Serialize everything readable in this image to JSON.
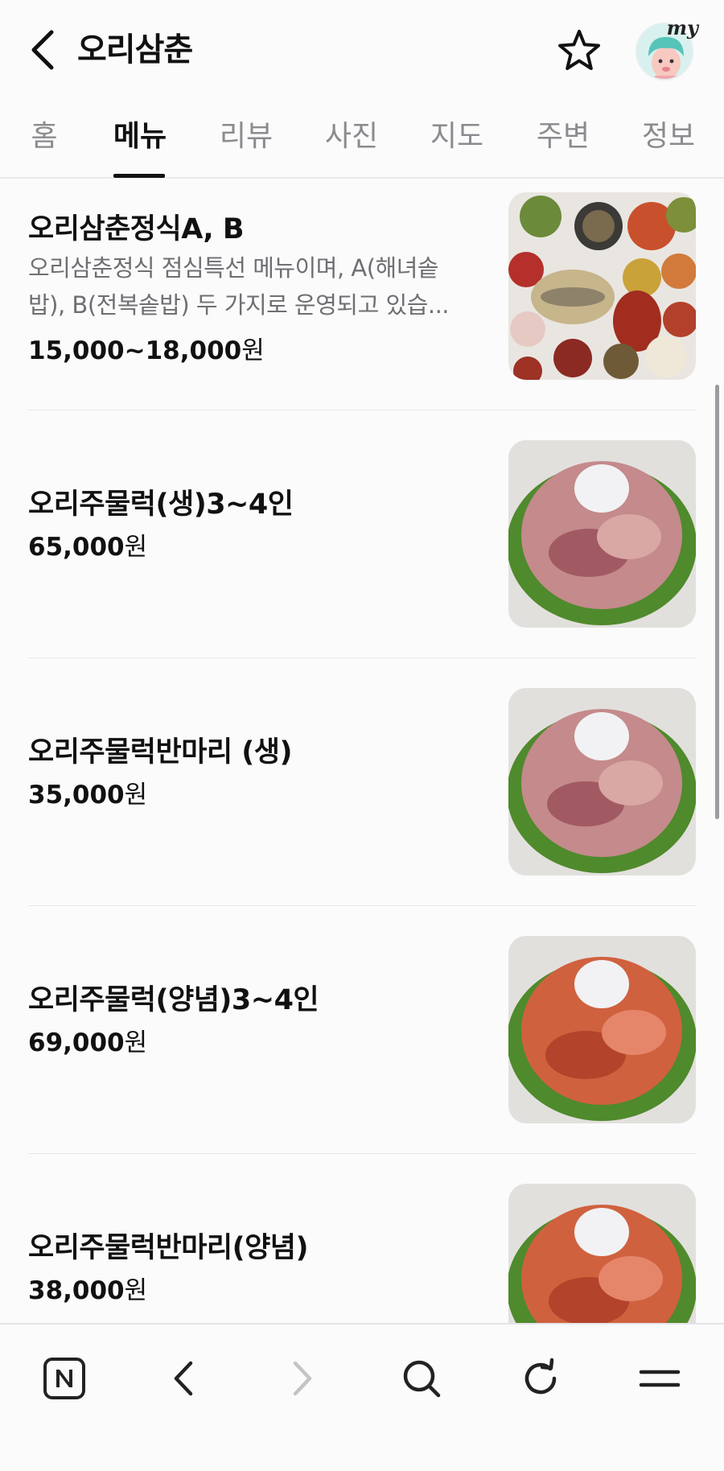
{
  "header": {
    "title": "오리삼춘",
    "avatar_badge": "my"
  },
  "tabs": [
    {
      "label": "홈",
      "active": false
    },
    {
      "label": "메뉴",
      "active": true
    },
    {
      "label": "리뷰",
      "active": false
    },
    {
      "label": "사진",
      "active": false
    },
    {
      "label": "지도",
      "active": false
    },
    {
      "label": "주변",
      "active": false
    },
    {
      "label": "정보",
      "active": false
    }
  ],
  "menu_items": [
    {
      "name": "오리삼춘정식A, B",
      "description_line1": "오리삼춘정식 점심특선 메뉴이며, A(해녀솥",
      "description_line2": "밥), B(전복솥밥) 두 가지로 운영되고 있습...",
      "price_number": "15,000~18,000",
      "price_unit": "원",
      "photo": "korean-set-meal-photo"
    },
    {
      "name": "오리주물럭(생)3~4인",
      "price_number": "65,000",
      "price_unit": "원",
      "photo": "raw-duck-bulgogi-photo"
    },
    {
      "name": "오리주물럭반마리 (생)",
      "price_number": "35,000",
      "price_unit": "원",
      "photo": "raw-duck-bulgogi-half-photo"
    },
    {
      "name": "오리주물럭(양념)3~4인",
      "price_number": "69,000",
      "price_unit": "원",
      "photo": "seasoned-duck-bulgogi-photo"
    },
    {
      "name": "오리주물럭반마리(양념)",
      "price_number": "38,000",
      "price_unit": "원",
      "photo": "seasoned-duck-bulgogi-half-photo"
    }
  ],
  "bottom_nav": [
    {
      "icon": "naver-home-icon",
      "enabled": true
    },
    {
      "icon": "back-arrow-icon",
      "enabled": true
    },
    {
      "icon": "forward-arrow-icon",
      "enabled": false
    },
    {
      "icon": "search-icon",
      "enabled": true
    },
    {
      "icon": "refresh-icon",
      "enabled": true
    },
    {
      "icon": "menu-icon",
      "enabled": true
    }
  ],
  "colors": {
    "background": "#fbfbfc",
    "text_primary": "#111111",
    "text_secondary": "#6f6f73",
    "tab_inactive": "#8b8b8f",
    "divider": "#e7e7ea",
    "disabled_icon": "#c4c4c8"
  }
}
